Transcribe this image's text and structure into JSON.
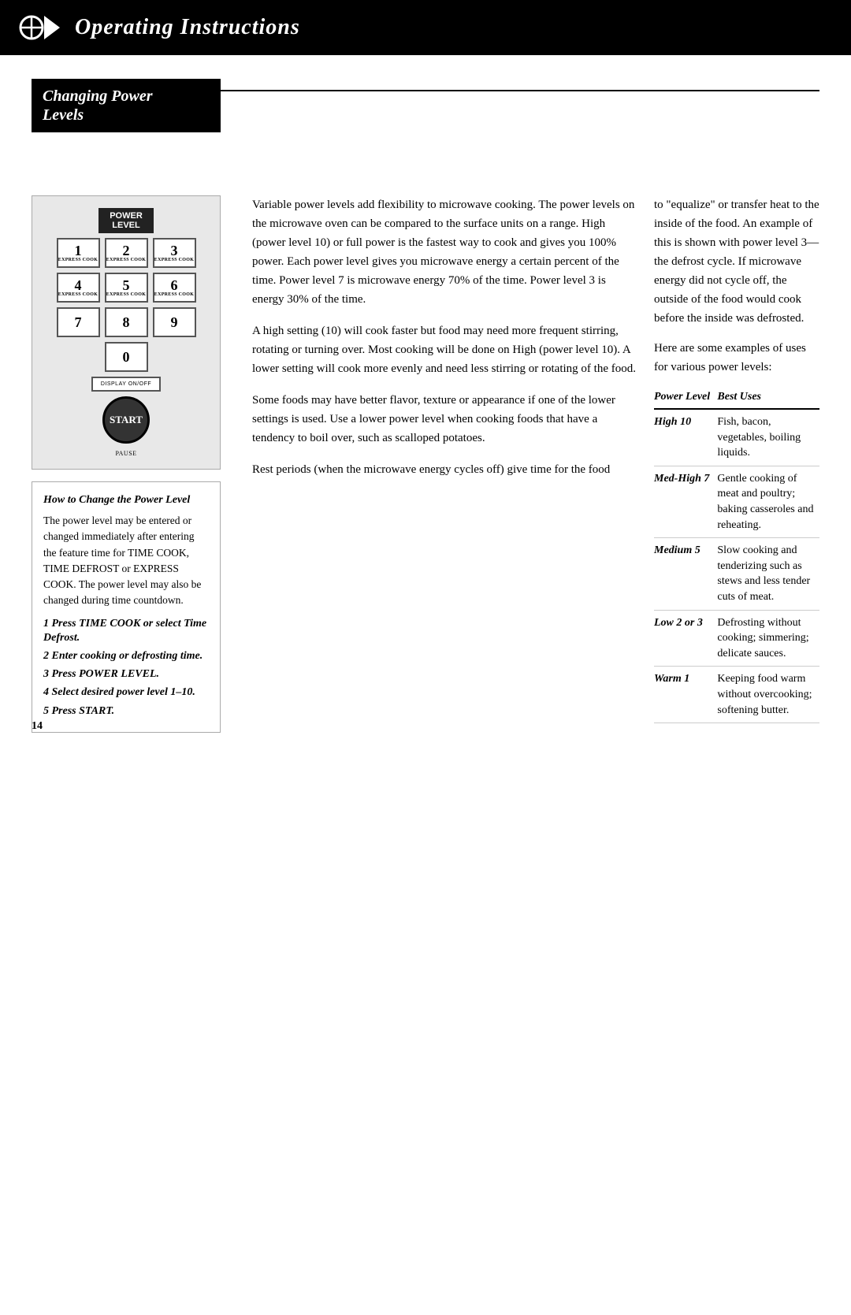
{
  "header": {
    "title": "Operating Instructions",
    "logo_alt": "Brand logo"
  },
  "section": {
    "title_line1": "Changing Power",
    "title_line2": "Levels"
  },
  "keypad": {
    "power_level_label_line1": "POWER",
    "power_level_label_line2": "LEVEL",
    "keys": [
      {
        "num": "1",
        "label": "EXPRESS COOK"
      },
      {
        "num": "2",
        "label": "EXPRESS COOK"
      },
      {
        "num": "3",
        "label": "EXPRESS COOK"
      },
      {
        "num": "4",
        "label": "EXPRESS COOK"
      },
      {
        "num": "5",
        "label": "EXPRESS COOK"
      },
      {
        "num": "6",
        "label": "EXPRESS COOK"
      },
      {
        "num": "7",
        "label": ""
      },
      {
        "num": "8",
        "label": ""
      },
      {
        "num": "9",
        "label": ""
      },
      {
        "num": "0",
        "label": ""
      }
    ],
    "display_btn": "DISPLAY ON/OFF",
    "start_btn": "START",
    "pause_btn": "PAUSE"
  },
  "how_to": {
    "title": "How to Change the Power Level",
    "body": "The power level may be entered or changed immediately after entering the feature time for TIME COOK, TIME DEFROST or EXPRESS COOK. The power level may also be changed during time countdown.",
    "steps": [
      {
        "num": "1",
        "text": "Press TIME COOK or select Time Defrost."
      },
      {
        "num": "2",
        "text": "Enter cooking or defrosting time."
      },
      {
        "num": "3",
        "text": "Press POWER LEVEL."
      },
      {
        "num": "4",
        "text": "Select desired power level 1–10."
      },
      {
        "num": "5",
        "text": "Press START."
      }
    ]
  },
  "middle_text": {
    "para1": "Variable power levels add flexibility to microwave cooking. The power levels on the microwave oven can be compared to the surface units on a range. High (power level 10) or full power is the fastest way to cook and gives you 100% power. Each power level gives you microwave energy a certain percent of the time. Power level 7 is microwave energy 70% of the time. Power level 3 is energy 30% of the time.",
    "para2": "A high setting (10) will cook faster but food may need more frequent stirring, rotating or turning over. Most cooking will be done on High (power level 10). A lower setting will cook more evenly and need less stirring or rotating of the food.",
    "para3": "Some foods may have better flavor, texture or appearance if one of the lower settings is used. Use a lower power level when cooking foods that have a tendency to boil over, such as scalloped potatoes.",
    "para4": "Rest periods (when the microwave energy cycles off) give time for the food"
  },
  "right_text": {
    "para1": "to \"equalize\" or transfer heat to the inside of the food. An example of this is shown with power level 3— the defrost cycle. If microwave energy did not cycle off, the outside of the food would cook before the inside was defrosted.",
    "para2": "Here are some examples of uses for various power levels:"
  },
  "power_table": {
    "col1_header": "Power Level",
    "col2_header": "Best Uses",
    "rows": [
      {
        "level": "High 10",
        "uses": "Fish, bacon, vegetables, boiling liquids."
      },
      {
        "level": "Med-High 7",
        "uses": "Gentle cooking of meat and poultry; baking casseroles and reheating."
      },
      {
        "level": "Medium 5",
        "uses": "Slow cooking and tenderizing such as stews and less tender cuts of meat."
      },
      {
        "level": "Low 2 or 3",
        "uses": "Defrosting without cooking; simmering; delicate sauces."
      },
      {
        "level": "Warm 1",
        "uses": "Keeping food warm without overcooking; softening butter."
      }
    ]
  },
  "page_number": "14"
}
